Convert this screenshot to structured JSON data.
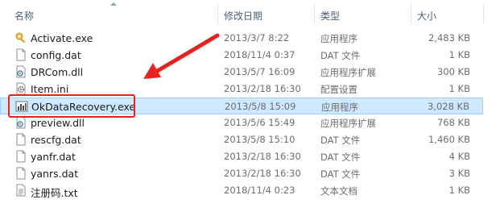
{
  "columns": {
    "name": "名称",
    "date": "修改日期",
    "type": "类型",
    "size": "大小"
  },
  "files": [
    {
      "name": "Activate.exe",
      "date": "2013/3/7 8:22",
      "type": "应用程序",
      "size": "2,483 KB",
      "icon": "app-key-icon"
    },
    {
      "name": "config.dat",
      "date": "2018/11/4 0:37",
      "type": "DAT 文件",
      "size": "1 KB",
      "icon": "blank-file-icon"
    },
    {
      "name": "DRCom.dll",
      "date": "2013/5/7 16:09",
      "type": "应用程序扩展",
      "size": "300 KB",
      "icon": "dll-file-icon"
    },
    {
      "name": "Item.ini",
      "date": "2013/2/18 16:30",
      "type": "配置设置",
      "size": "1 KB",
      "icon": "settings-file-icon"
    },
    {
      "name": "OkDataRecovery.exe",
      "date": "2013/5/8 15:09",
      "type": "应用程序",
      "size": "3,028 KB",
      "icon": "app-chart-icon"
    },
    {
      "name": "preview.dll",
      "date": "2013/5/6 15:49",
      "type": "应用程序扩展",
      "size": "768 KB",
      "icon": "dll-file-icon"
    },
    {
      "name": "rescfg.dat",
      "date": "2013/5/8 15:10",
      "type": "DAT 文件",
      "size": "1,460 KB",
      "icon": "blank-file-icon"
    },
    {
      "name": "yanfr.dat",
      "date": "2013/2/18 16:30",
      "type": "DAT 文件",
      "size": "4 KB",
      "icon": "blank-file-icon"
    },
    {
      "name": "yanrs.dat",
      "date": "2013/2/18 16:30",
      "type": "DAT 文件",
      "size": "3 KB",
      "icon": "blank-file-icon"
    },
    {
      "name": "注册码.txt",
      "date": "2018/11/4 0:23",
      "type": "文本文档",
      "size": "1 KB",
      "icon": "text-file-icon"
    }
  ],
  "selected_index": 4,
  "colors": {
    "selection_bg": "#cde8ff",
    "selection_border": "#99d1ff",
    "annotation_red": "#e8231f",
    "header_text": "#4c607a"
  }
}
